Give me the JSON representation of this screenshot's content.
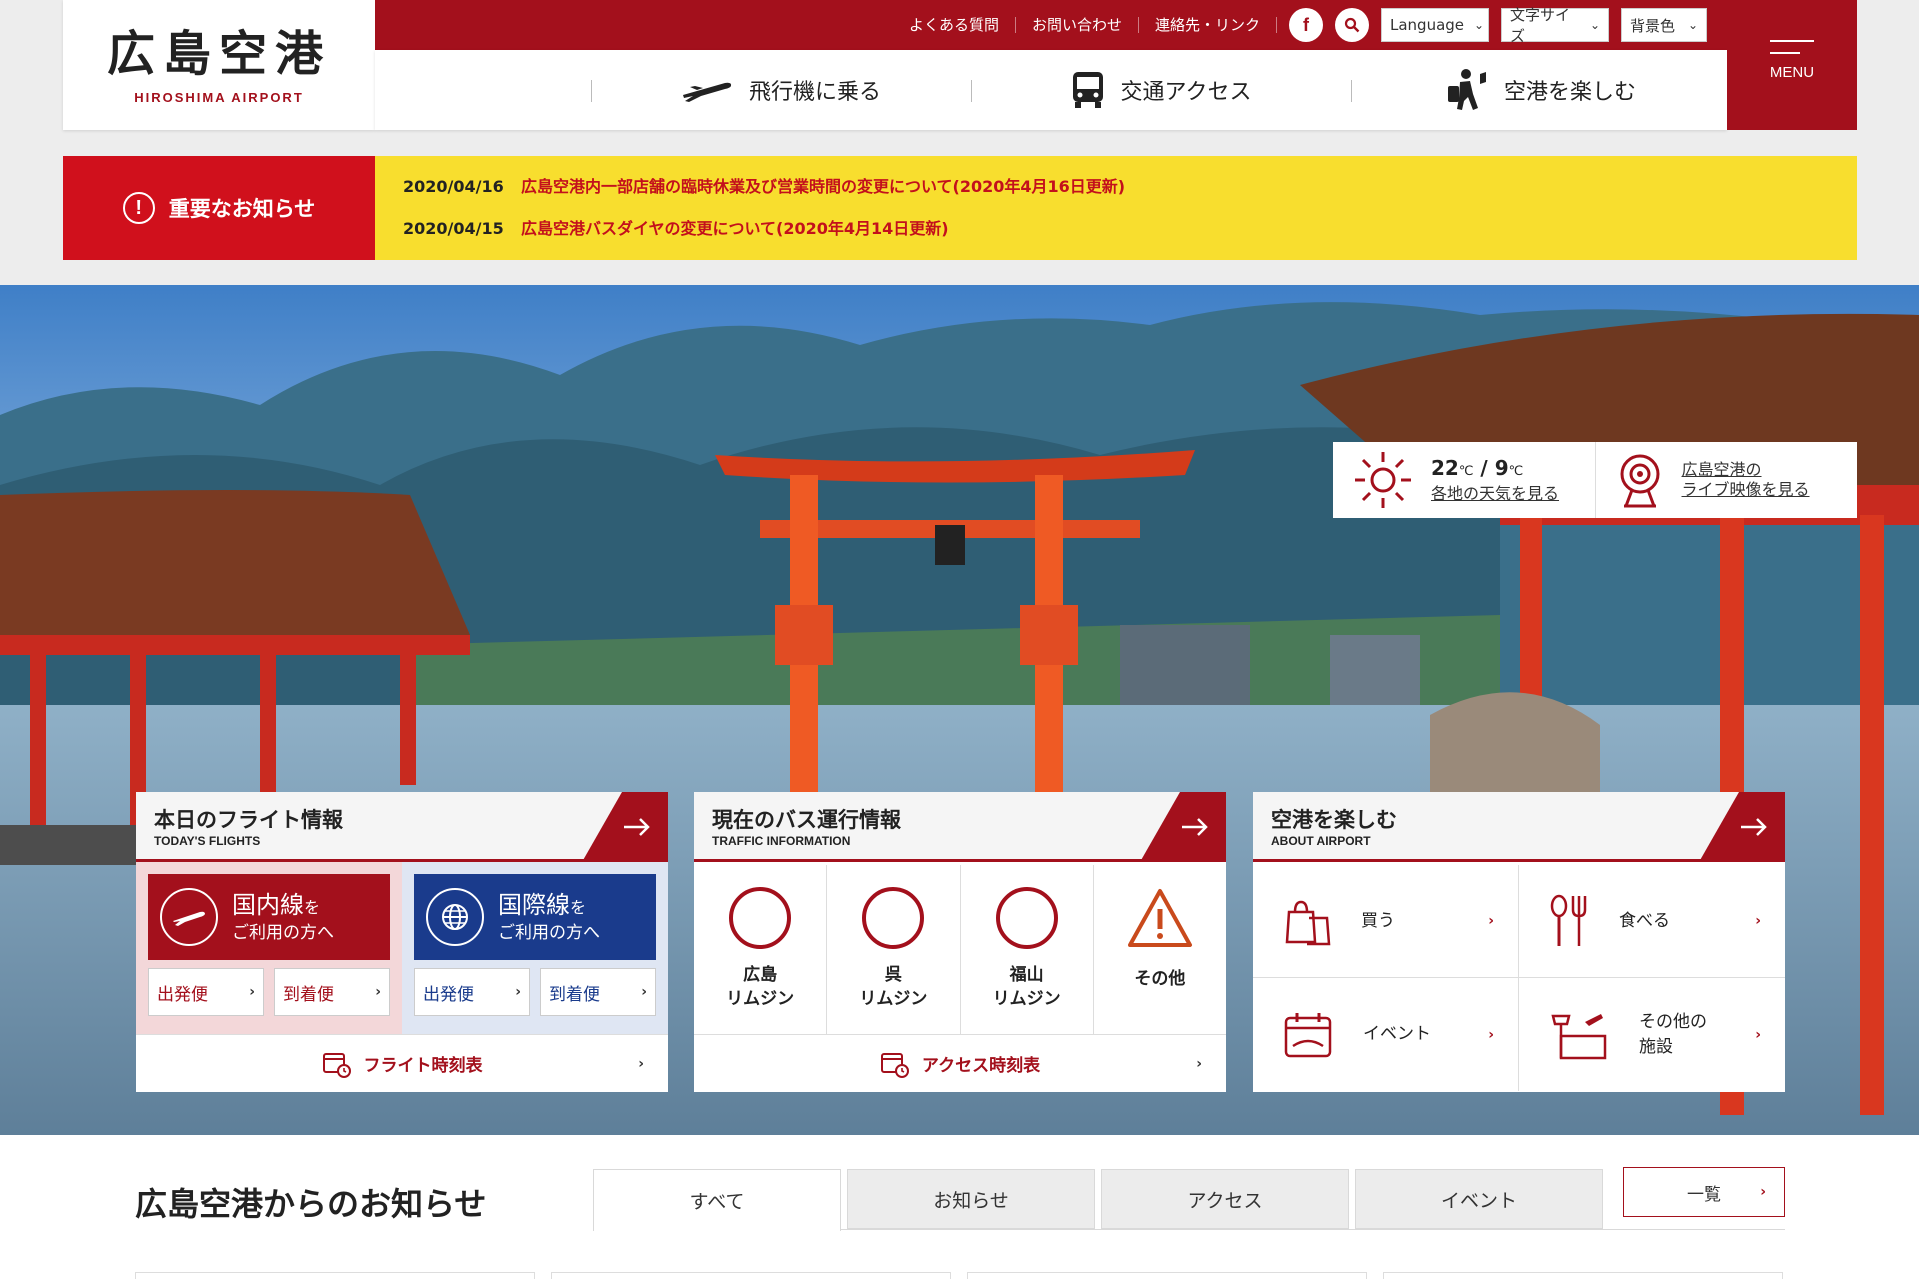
{
  "brand": {
    "title_jp": "広島空港",
    "title_en": "HIROSHIMA AIRPORT",
    "accent": "#a3101c",
    "alert": "#d0101c",
    "notice_bg": "#f8de2e",
    "intl_blue": "#1a3b8c"
  },
  "top_links": [
    "よくある質問",
    "お問い合わせ",
    "連絡先・リンク"
  ],
  "top_icons": {
    "facebook": "facebook-icon",
    "search": "search-icon"
  },
  "selects": {
    "language": "Language",
    "font_size": "文字サイズ",
    "bg_color": "背景色"
  },
  "nav": [
    {
      "label": "飛行機に乗る",
      "icon": "airplane-icon"
    },
    {
      "label": "交通アクセス",
      "icon": "bus-icon"
    },
    {
      "label": "空港を楽しむ",
      "icon": "walking-traveler-icon"
    }
  ],
  "menu_label": "MENU",
  "notice": {
    "label": "重要なお知らせ",
    "items": [
      {
        "date": "2020/04/16",
        "text": "広島空港内一部店舗の臨時休業及び営業時間の変更について(2020年4月16日更新)"
      },
      {
        "date": "2020/04/15",
        "text": "広島空港バスダイヤの変更について(2020年4月14日更新)"
      }
    ]
  },
  "weather": {
    "high": "22",
    "low": "9",
    "unit": "℃",
    "sep": " / ",
    "link": "各地の天気を見る",
    "live_line1": "広島空港の",
    "live_line2": "ライブ映像を見る"
  },
  "flights": {
    "title": "本日のフライト情報",
    "subtitle": "TODAY'S FLIGHTS",
    "domestic": {
      "name": "国内線",
      "suffix": "を",
      "desc": "ご利用の方へ",
      "departures": "出発便",
      "arrivals": "到着便"
    },
    "international": {
      "name": "国際線",
      "suffix": "を",
      "desc": "ご利用の方へ",
      "departures": "出発便",
      "arrivals": "到着便"
    },
    "footer": "フライト時刻表"
  },
  "bus": {
    "title": "現在のバス運行情報",
    "subtitle": "TRAFFIC INFORMATION",
    "routes": [
      {
        "line1": "広島",
        "line2": "リムジン"
      },
      {
        "line1": "呉",
        "line2": "リムジン"
      },
      {
        "line1": "福山",
        "line2": "リムジン"
      },
      {
        "line1": "その他",
        "line2": ""
      }
    ],
    "footer": "アクセス時刻表"
  },
  "enjoy": {
    "title": "空港を楽しむ",
    "subtitle": "ABOUT AIRPORT",
    "items": [
      {
        "line1": "買う",
        "line2": "",
        "icon": "shopping-bag-icon"
      },
      {
        "line1": "食べる",
        "line2": "",
        "icon": "spoon-fork-icon"
      },
      {
        "line1": "イベント",
        "line2": "",
        "icon": "calendar-icon"
      },
      {
        "line1": "その他の",
        "line2": "施設",
        "icon": "facility-icon"
      }
    ]
  },
  "news": {
    "title": "広島空港からのお知らせ",
    "tabs": [
      "すべて",
      "お知らせ",
      "アクセス",
      "イベント"
    ],
    "list_button": "一覧"
  }
}
